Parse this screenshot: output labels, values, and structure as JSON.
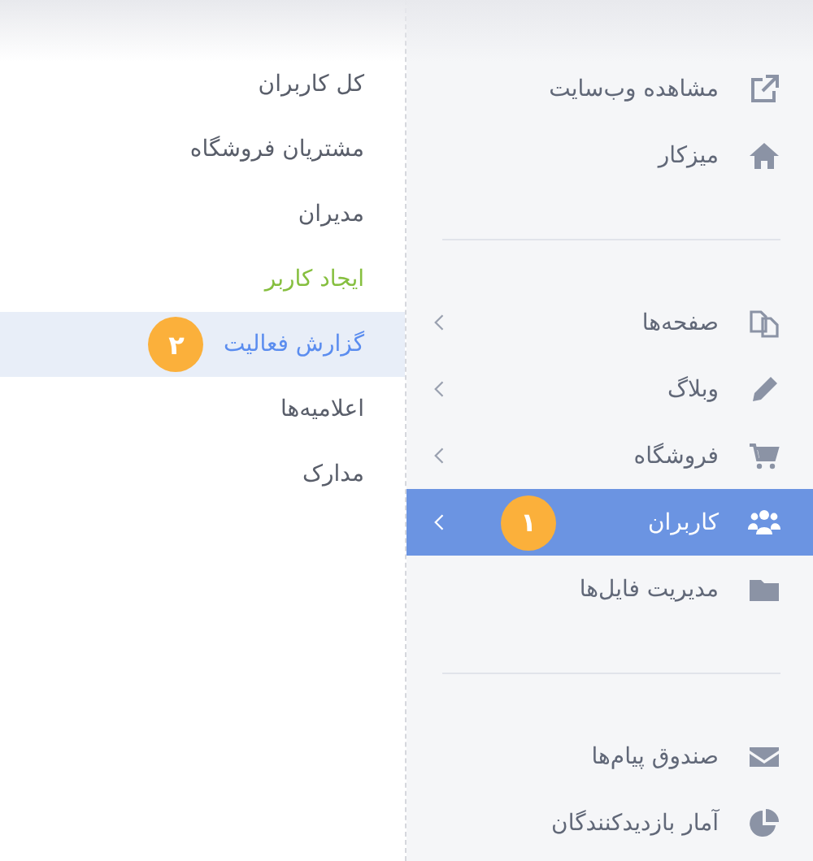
{
  "submenu": {
    "items": [
      {
        "label": "کل کاربران",
        "kind": "link",
        "selected": false
      },
      {
        "label": "مشتریان فروشگاه",
        "kind": "link",
        "selected": false
      },
      {
        "label": "مدیران",
        "kind": "link",
        "selected": false
      },
      {
        "label": "ایجاد کاربر",
        "kind": "action",
        "selected": false
      },
      {
        "label": "گزارش فعالیت",
        "kind": "link",
        "selected": true,
        "badge": "۲"
      },
      {
        "label": "اعلامیه‌ها",
        "kind": "link",
        "selected": false
      },
      {
        "label": "مدارک",
        "kind": "link",
        "selected": false
      }
    ]
  },
  "main_menu": {
    "sections": [
      {
        "items": [
          {
            "label": "مشاهده وب‌سایت",
            "has_submenu": false,
            "selected": false
          },
          {
            "label": "میزکار",
            "has_submenu": false,
            "selected": false
          }
        ]
      },
      {
        "items": [
          {
            "label": "صفحه‌ها",
            "has_submenu": true,
            "selected": false
          },
          {
            "label": "وبلاگ",
            "has_submenu": true,
            "selected": false
          },
          {
            "label": "فروشگاه",
            "has_submenu": true,
            "selected": false
          },
          {
            "label": "کاربران",
            "has_submenu": true,
            "selected": true,
            "badge": "۱"
          },
          {
            "label": "مدیریت فایل‌ها",
            "has_submenu": false,
            "selected": false
          }
        ]
      },
      {
        "items": [
          {
            "label": "صندوق پیام‌ها",
            "has_submenu": false,
            "selected": false
          },
          {
            "label": "آمار بازدیدکنندگان",
            "has_submenu": false,
            "selected": false
          }
        ]
      }
    ]
  }
}
